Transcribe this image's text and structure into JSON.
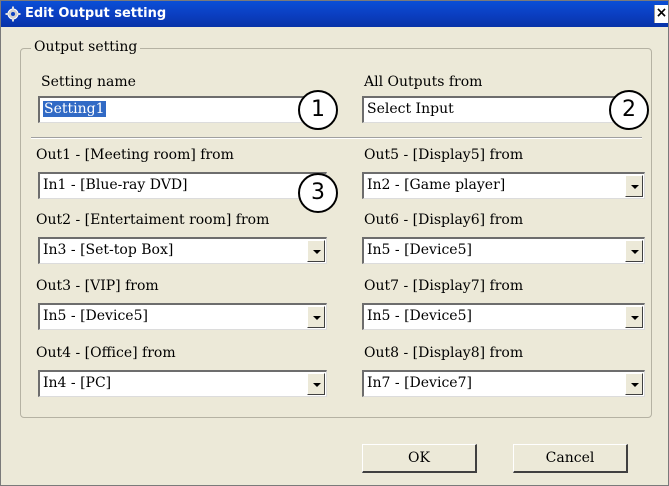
{
  "window": {
    "title": "Edit Output setting",
    "close_glyph": "×"
  },
  "group": {
    "legend": "Output setting"
  },
  "setting_name": {
    "label": "Setting name",
    "value": "Setting1"
  },
  "all_outputs": {
    "label": "All Outputs from",
    "value": "Select Input"
  },
  "outputs": [
    {
      "label": "Out1 - [Meeting room] from",
      "value": "In1 - [Blue-ray DVD]"
    },
    {
      "label": "Out2 - [Entertaiment room] from",
      "value": "In3 - [Set-top Box]"
    },
    {
      "label": "Out3 - [VIP] from",
      "value": "In5 - [Device5]"
    },
    {
      "label": "Out4 - [Office] from",
      "value": "In4 - [PC]"
    },
    {
      "label": "Out5 - [Display5] from",
      "value": "In2 - [Game player]"
    },
    {
      "label": "Out6 - [Display6] from",
      "value": "In5 - [Device5]"
    },
    {
      "label": "Out7 - [Display7] from",
      "value": "In5 - [Device5]"
    },
    {
      "label": "Out8 - [Display8] from",
      "value": "In7 - [Device7]"
    }
  ],
  "callouts": [
    "1",
    "2",
    "3"
  ],
  "buttons": {
    "ok": "OK",
    "cancel": "Cancel"
  },
  "icons": {
    "app": "gear-icon",
    "close": "close-icon",
    "dropdown": "chevron-down-icon"
  }
}
